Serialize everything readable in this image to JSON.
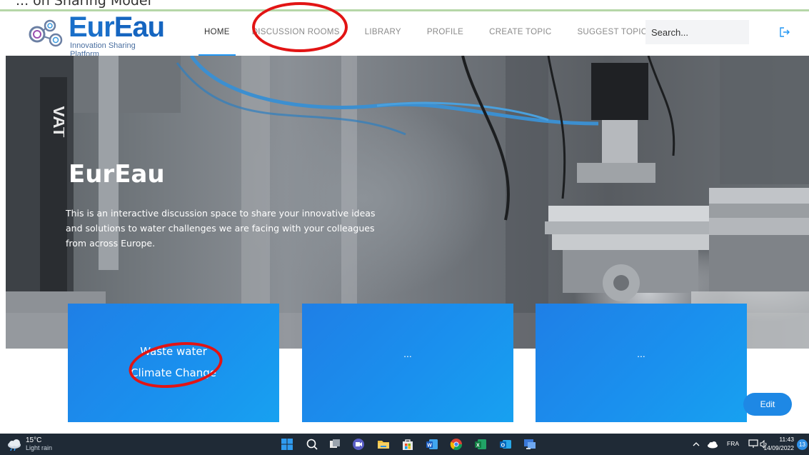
{
  "window": {
    "cropped_caption": "... on Sharing Model"
  },
  "brand": {
    "name_part1": "Eur",
    "name_part2": "Eau",
    "tagline": "Innovation Sharing Platform"
  },
  "nav": {
    "items": [
      {
        "label": "HOME",
        "active": true
      },
      {
        "label": "DISCUSSION ROOMS"
      },
      {
        "label": "LIBRARY"
      },
      {
        "label": "PROFILE"
      },
      {
        "label": "CREATE TOPIC"
      },
      {
        "label": "SUGGEST TOPIC"
      }
    ],
    "search_placeholder": "Search..."
  },
  "hero": {
    "title": "EurEau",
    "description": "This is an interactive discussion space to share your innovative ideas and solutions to water challenges we are facing with your colleagues from across Europe.",
    "machine_label": "VAT"
  },
  "cards": [
    {
      "line1": "Waste water",
      "line2": "Climate Change"
    },
    {
      "line1": "..."
    },
    {
      "line1": "..."
    }
  ],
  "edit_label": "Edit",
  "taskbar": {
    "weather_temp": "15°C",
    "weather_desc": "Light rain",
    "language": "FRA",
    "time": "11:43",
    "date": "14/09/2022",
    "notification_count": "13"
  },
  "colors": {
    "accent": "#2196f3",
    "brand_blue": "#1565c0",
    "card_blue": "#1a90ee",
    "annotation_red": "#e21414",
    "taskbar": "#1f2a36"
  }
}
